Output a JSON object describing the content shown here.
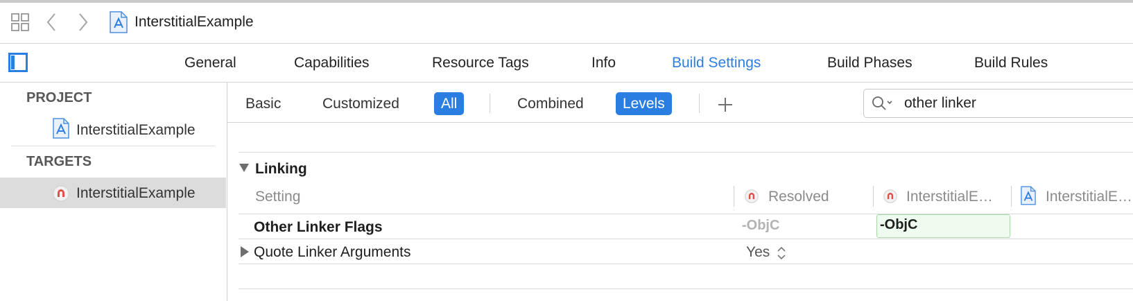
{
  "breadcrumb": {
    "project_name": "InterstitialExample"
  },
  "tabs": [
    {
      "label": "General",
      "active": false
    },
    {
      "label": "Capabilities",
      "active": false
    },
    {
      "label": "Resource Tags",
      "active": false
    },
    {
      "label": "Info",
      "active": false
    },
    {
      "label": "Build Settings",
      "active": true
    },
    {
      "label": "Build Phases",
      "active": false
    },
    {
      "label": "Build Rules",
      "active": false
    }
  ],
  "sidebar": {
    "project_heading": "PROJECT",
    "project_item": "InterstitialExample",
    "targets_heading": "TARGETS",
    "target_item": "InterstitialExample"
  },
  "filter": {
    "segments": [
      "Basic",
      "Customized",
      "All",
      "Combined",
      "Levels"
    ],
    "active_scope": "All",
    "active_view": "Levels",
    "add_symbol": "+",
    "search_value": "other linker"
  },
  "section": {
    "title": "Linking",
    "columns": {
      "setting": "Setting",
      "resolved": "Resolved",
      "target": "InterstitialE…",
      "project": "InterstitialE…"
    },
    "rows": [
      {
        "name": "Other Linker Flags",
        "resolved": "-ObjC",
        "target_value": "-ObjC"
      },
      {
        "name": "Quote Linker Arguments",
        "resolved": "Yes",
        "stepper": "⌃⌄"
      }
    ]
  },
  "colors": {
    "accent": "#2a7de1",
    "selection": "#dcdcdc",
    "green_fill": "#eefbee",
    "target_icon": "#e0504a"
  }
}
